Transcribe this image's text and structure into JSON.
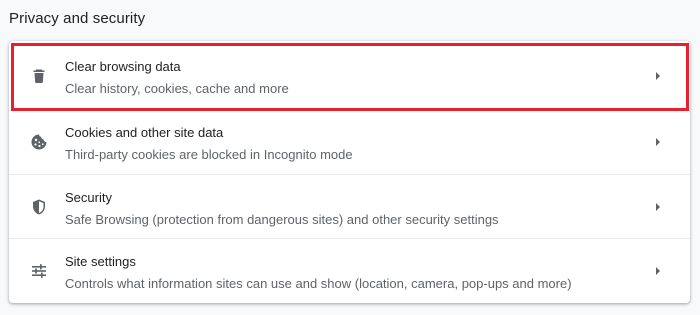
{
  "section": {
    "title": "Privacy and security"
  },
  "items": [
    {
      "label": "Clear browsing data",
      "sublabel": "Clear history, cookies, cache and more",
      "icon": "trash-icon",
      "highlighted": true
    },
    {
      "label": "Cookies and other site data",
      "sublabel": "Third-party cookies are blocked in Incognito mode",
      "icon": "cookie-icon"
    },
    {
      "label": "Security",
      "sublabel": "Safe Browsing (protection from dangerous sites) and other security settings",
      "icon": "shield-icon"
    },
    {
      "label": "Site settings",
      "sublabel": "Controls what information sites can use and show (location, camera, pop-ups and more)",
      "icon": "sliders-icon"
    }
  ],
  "colors": {
    "highlight_border": "#e8202e",
    "icon": "#5f6368",
    "text_primary": "#202124",
    "text_secondary": "#5f6368"
  }
}
